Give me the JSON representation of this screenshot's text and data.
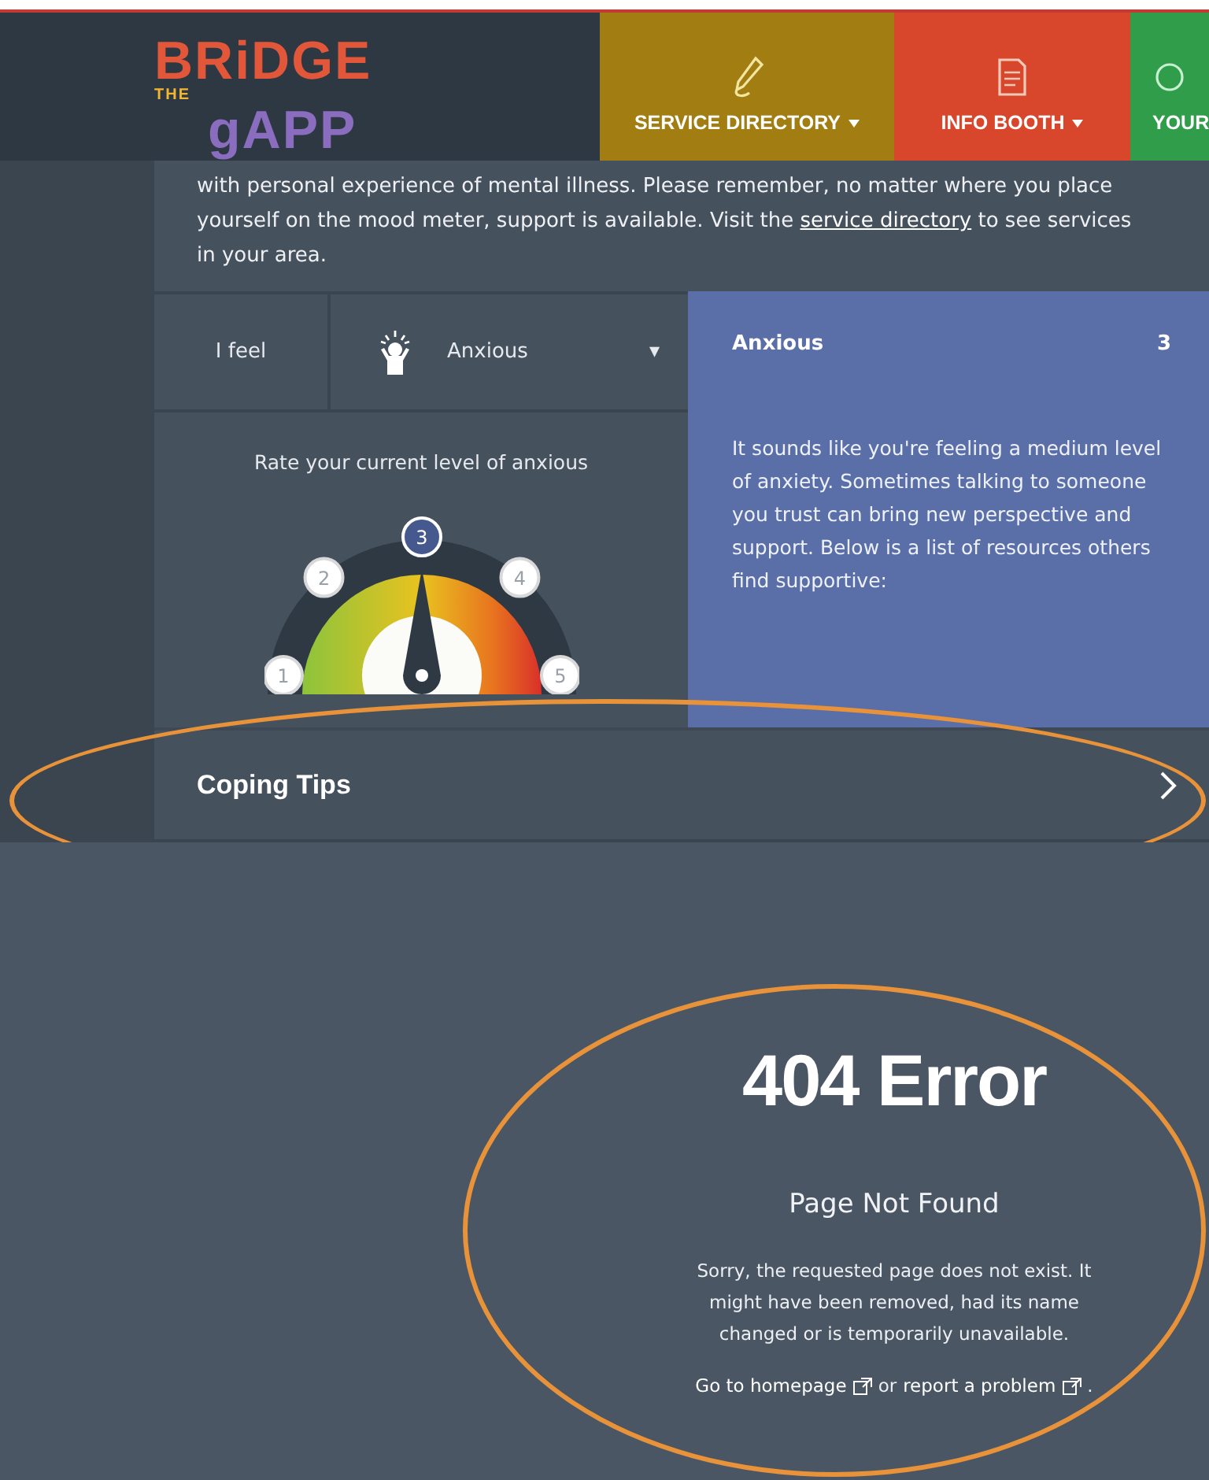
{
  "logo": {
    "words": [
      "BRiDGE",
      "THE",
      "gAPP"
    ]
  },
  "nav": [
    {
      "label": "SERVICE DIRECTORY",
      "color": "#a27d12",
      "kind": "pen",
      "dropdown": true
    },
    {
      "label": "INFO BOOTH",
      "color": "#d8472b",
      "kind": "note",
      "dropdown": true
    },
    {
      "label": "YOUR",
      "color": "#2f9d4a",
      "kind": "circle",
      "dropdown": false
    }
  ],
  "intro": {
    "lead": "with personal experience of mental illness. Please remember, no matter where you place yourself on the mood meter, support is available. Visit the ",
    "link": "service directory",
    "tail": " to see services in your area."
  },
  "mood": {
    "label": "I feel",
    "select": {
      "value": "Anxious",
      "caret": "▾"
    },
    "rating_prompt": "Rate your current level of anxious",
    "rating": {
      "options": [
        {
          "label": "1",
          "selected": false
        },
        {
          "label": "2",
          "selected": false
        },
        {
          "label": "3",
          "selected": true
        },
        {
          "label": "4",
          "selected": false
        },
        {
          "label": "5",
          "selected": false
        }
      ]
    },
    "result": {
      "title": "Anxious",
      "score": "3",
      "text": "It sounds like you're feeling a medium level of anxiety. Sometimes talking to someone you trust can bring new perspective and support. Below is a list of resources others find supportive:"
    }
  },
  "coping_tips": {
    "label": "Coping Tips",
    "highlighted": true
  },
  "error": {
    "highlighted": true,
    "code": "404 Error",
    "title": "Page Not Found",
    "message": "Sorry, the requested page does not exist. It might have been removed, had its name changed or is temporarily unavailable.",
    "home_link": "Go to homepage",
    "joiner": "or",
    "report_link": "report a problem",
    "end": "."
  }
}
